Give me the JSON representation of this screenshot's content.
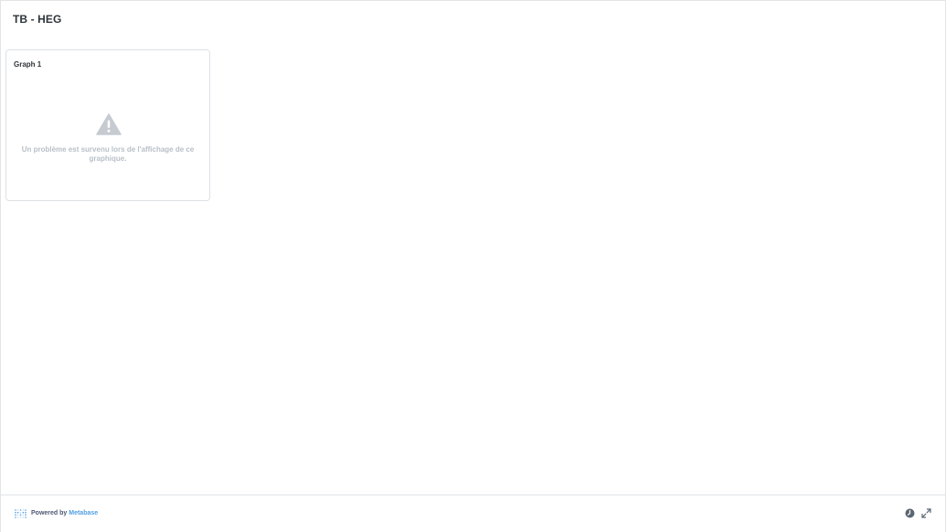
{
  "dashboard": {
    "title": "TB - HEG"
  },
  "card": {
    "title": "Graph 1",
    "icon": "warning-triangle-icon",
    "error_message": "Un problème est survenu lors de l'affichage de ce graphique."
  },
  "footer": {
    "powered_by": "Powered by",
    "brand_link": "Metabase",
    "brand_color": "#509ee3",
    "icons": [
      "metabase-logo-icon",
      "clock-icon",
      "expand-icon"
    ]
  },
  "colors": {
    "border": "#e2e4e6",
    "muted_text": "#b8c0c8",
    "icon_gray": "#c5cbd1"
  }
}
